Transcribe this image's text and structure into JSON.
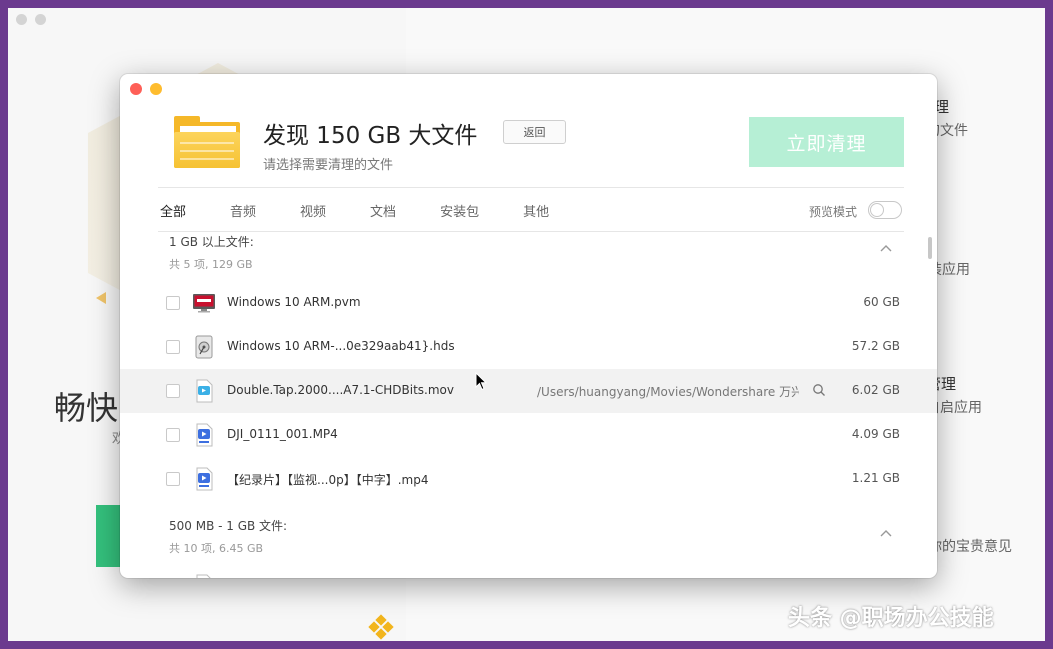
{
  "background": {
    "left_title": "畅快",
    "left_sub": "欢",
    "right_items": [
      {
        "text": "理",
        "kind": "h"
      },
      {
        "text": "的文件",
        "kind": "s"
      },
      {
        "text": "装应用",
        "kind": "s"
      },
      {
        "text": "管理",
        "kind": "h"
      },
      {
        "text": "自启应用",
        "kind": "s"
      },
      {
        "text": "你的宝贵意见",
        "kind": "s"
      }
    ]
  },
  "dialog": {
    "title": "发现 150 GB 大文件",
    "subtitle": "请选择需要清理的文件",
    "back_label": "返回",
    "clean_label": "立即清理",
    "tabs": [
      "全部",
      "音频",
      "视频",
      "文档",
      "安装包",
      "其他"
    ],
    "preview_label": "预览模式",
    "groups": [
      {
        "title": "1 GB 以上文件:",
        "count": "共 5 项, 129 GB",
        "files": [
          {
            "name": "Windows 10 ARM.pvm",
            "icon": "parallels-vm-icon",
            "path": "",
            "size": "60 GB"
          },
          {
            "name": "Windows 10 ARM-...0e329aab41}.hds",
            "icon": "disk-image-icon",
            "path": "",
            "size": "57.2 GB"
          },
          {
            "name": "Double.Tap.2000....A7.1-CHDBits.mov",
            "icon": "video-file-icon",
            "path": "/Users/huangyang/Movies/Wondershare 万兴",
            "size": "6.02 GB"
          },
          {
            "name": "DJI_0111_001.MP4",
            "icon": "video-file-icon",
            "path": "",
            "size": "4.09 GB"
          },
          {
            "name": "【纪录片】【监视...0p】【中字】.mp4",
            "icon": "video-file-icon",
            "path": "",
            "size": "1.21 GB"
          }
        ]
      },
      {
        "title": "500 MB - 1 GB 文件:",
        "count": "共 10 项, 6.45 GB",
        "files": []
      }
    ]
  },
  "watermark": "头条 @职场办公技能",
  "colors": {
    "accent_green": "#b6efd5",
    "folder_yellow": "#f5b829",
    "video_blue": "#3d6fe0",
    "frame_purple": "#6b3a8e"
  }
}
